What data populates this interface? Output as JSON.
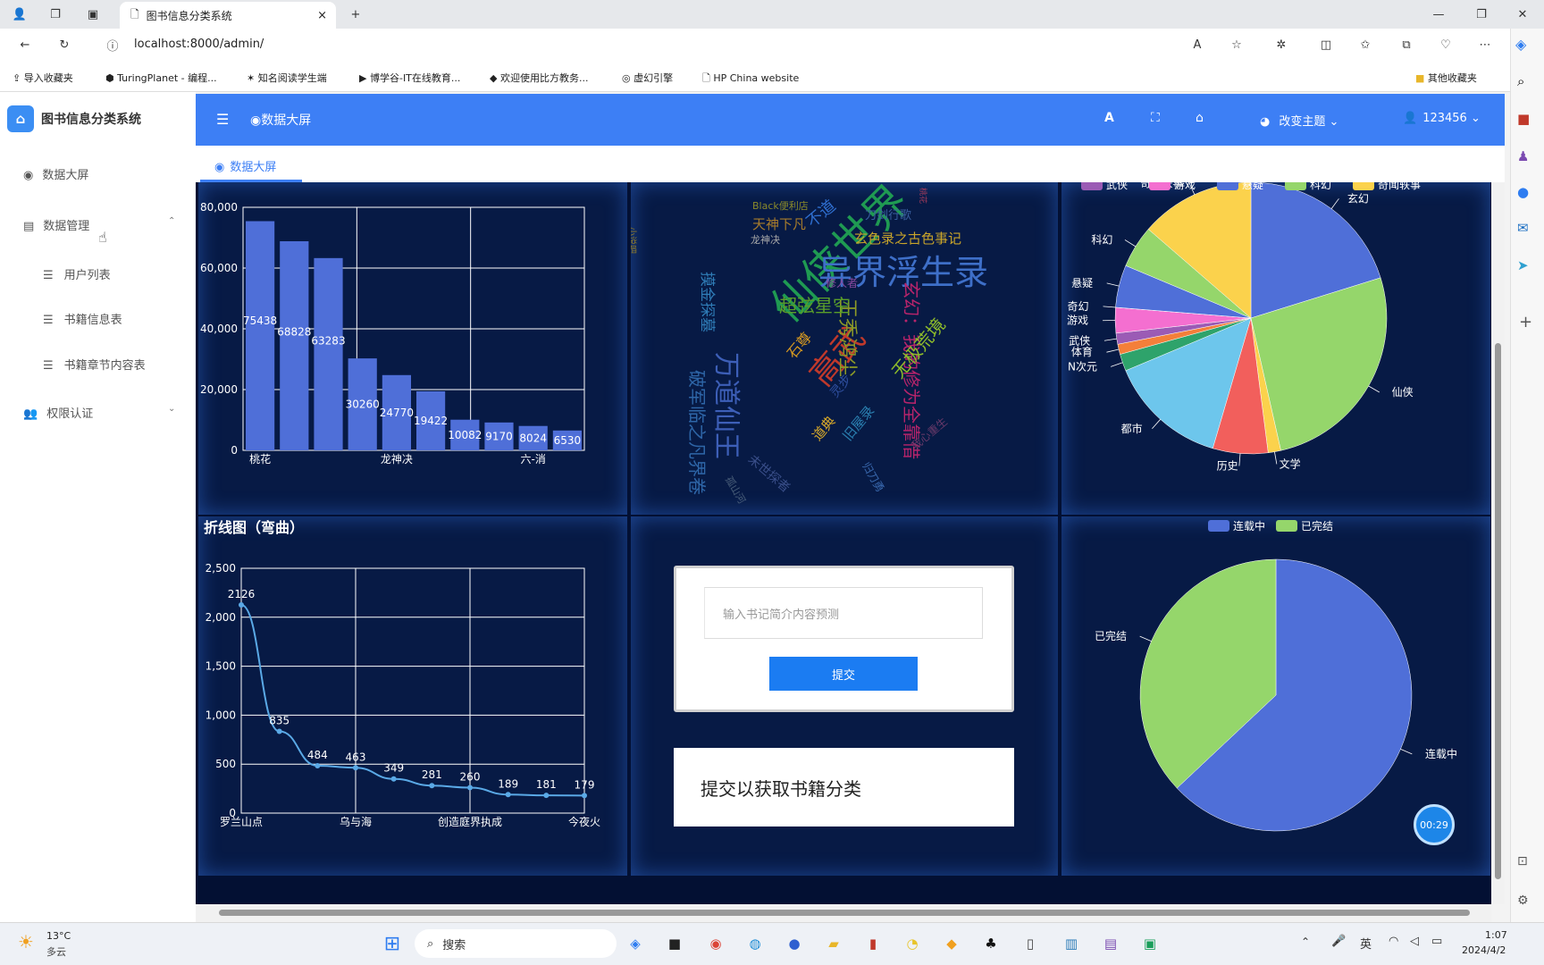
{
  "browser": {
    "tab_title": "图书信息分类系统",
    "tab_close": "×",
    "new_tab": "+",
    "url": "localhost:8000/admin/",
    "bookmarks": [
      "导入收藏夹",
      "TuringPlanet - 编程...",
      "知名阅读学生端",
      "博学谷-IT在线教育...",
      "欢迎使用比方教务...",
      "虚幻引擎",
      "HP China website"
    ],
    "other_bookmarks": "其他收藏夹"
  },
  "sidebar": {
    "brand": "图书信息分类系统",
    "items": [
      {
        "label": "数据大屏"
      },
      {
        "label": "数据管理"
      },
      {
        "label": "用户列表"
      },
      {
        "label": "书籍信息表"
      },
      {
        "label": "书籍章节内容表"
      },
      {
        "label": "权限认证"
      }
    ]
  },
  "header": {
    "title": "数据大屏",
    "theme": "改变主题",
    "user": "123456"
  },
  "page_tab": "数据大屏",
  "wordcloud": [
    {
      "text": "仙侠世界",
      "color": "#1f9a52"
    },
    {
      "text": "异界浮生录",
      "color": "#3e6fc8"
    },
    {
      "text": "万道仙王",
      "color": "#3d5fb8"
    },
    {
      "text": "高武",
      "color": "#c0392b"
    },
    {
      "text": "玄幻：我的修为全靠借",
      "color": "#b8246b"
    },
    {
      "text": "王秀鸿尘",
      "color": "#8c9a28"
    },
    {
      "text": "超弦星空",
      "color": "#5a9e2a"
    },
    {
      "text": "玄色录之古色事记",
      "color": "#c8a42a"
    },
    {
      "text": "破军临之凡界卷",
      "color": "#2e66a8"
    },
    {
      "text": "摸金探墓",
      "color": "#2f7db8"
    },
    {
      "text": "无极荒境",
      "color": "#8fbd2a"
    },
    {
      "text": "天神下凡",
      "color": "#a77b2b"
    },
    {
      "text": "石尊",
      "color": "#d89a20"
    },
    {
      "text": "道典",
      "color": "#d8a92a"
    },
    {
      "text": "旧屋录",
      "color": "#2a7fb0"
    },
    {
      "text": "Black便利店",
      "color": "#8a8a2a"
    },
    {
      "text": "龙神决",
      "color": "#aaaaaa"
    },
    {
      "text": "刀剑行歌",
      "color": "#3a5fa0"
    },
    {
      "text": "不道",
      "color": "#2f6fd0"
    },
    {
      "text": "修人者",
      "color": "#8a4aa0"
    },
    {
      "text": "未世探者",
      "color": "#3a4f8a"
    },
    {
      "text": "灵步",
      "color": "#2f4fa0"
    },
    {
      "text": "我心重生",
      "color": "#6a3a6a"
    },
    {
      "text": "桃花",
      "color": "#a03a5a"
    },
    {
      "text": "小说吧",
      "color": "#8f7a2a"
    },
    {
      "text": "归刀勇",
      "color": "#3a6ab0"
    },
    {
      "text": "孤山河",
      "color": "#4a5f7a"
    }
  ],
  "predict": {
    "placeholder": "输入书记简介内容预测",
    "submit": "提交",
    "result": "提交以获取书籍分类"
  },
  "timer": "00:29",
  "taskbar": {
    "weather_temp": "13°C",
    "weather_desc": "多云",
    "search": "搜索",
    "ime": "英",
    "time": "1:07",
    "date": "2024/4/2"
  },
  "chart_data": [
    {
      "type": "bar",
      "categories": [
        "桃花",
        "",
        "",
        "",
        "龙神决",
        "",
        "",
        "",
        "六-消",
        ""
      ],
      "values": [
        75438,
        68828,
        63283,
        30260,
        24770,
        19422,
        10082,
        9170,
        8024,
        6530
      ],
      "ylim": [
        0,
        80000
      ],
      "yticks": [
        "0",
        "20,000",
        "40,000",
        "60,000",
        "80,000"
      ],
      "color": "#4f6fd8"
    },
    {
      "type": "line",
      "title": "折线图（弯曲）",
      "categories": [
        "罗兰山点",
        "",
        "",
        "乌与海",
        "",
        "",
        "创造庭界执成",
        "",
        "",
        "今夜火"
      ],
      "values": [
        2126,
        835,
        484,
        463,
        349,
        281,
        260,
        189,
        181,
        179
      ],
      "ylim": [
        0,
        2500
      ],
      "yticks": [
        "0",
        "500",
        "1,000",
        "1,500",
        "2,000",
        "2,500"
      ],
      "color": "#5aa9e6"
    },
    {
      "type": "pie",
      "legend": [
        "武侠",
        "游戏",
        "悬疑",
        "科幻",
        "奇闻轶事"
      ],
      "slices": [
        {
          "name": "玄幻",
          "value": 20,
          "color": "#4f6fd8"
        },
        {
          "name": "仙侠",
          "value": 26,
          "color": "#95d66b"
        },
        {
          "name": "文学",
          "value": 1.5,
          "color": "#fbd24c"
        },
        {
          "name": "历史",
          "value": 6.5,
          "color": "#f25f5c"
        },
        {
          "name": "都市",
          "value": 14,
          "color": "#6dc6ec"
        },
        {
          "name": "N次元",
          "value": 2,
          "color": "#2ea36b"
        },
        {
          "name": "体育",
          "value": 1.2,
          "color": "#f47f3a"
        },
        {
          "name": "武侠",
          "value": 1.3,
          "color": "#9b5bb5"
        },
        {
          "name": "游戏",
          "value": 3,
          "color": "#f46fd0"
        },
        {
          "name": "奇幻",
          "value": 0.01,
          "color": "#4f6fd8"
        },
        {
          "name": "悬疑",
          "value": 5,
          "color": "#4f6fd8"
        },
        {
          "name": "科幻",
          "value": 5,
          "color": "#95d66b"
        },
        {
          "name": "奇闻轶事",
          "value": 13.5,
          "color": "#fbd24c"
        }
      ]
    },
    {
      "type": "pie",
      "legend": [
        "连载中",
        "已完结"
      ],
      "slices": [
        {
          "name": "连载中",
          "value": 63,
          "color": "#4f6fd8"
        },
        {
          "name": "已完结",
          "value": 37,
          "color": "#95d66b"
        }
      ]
    }
  ]
}
